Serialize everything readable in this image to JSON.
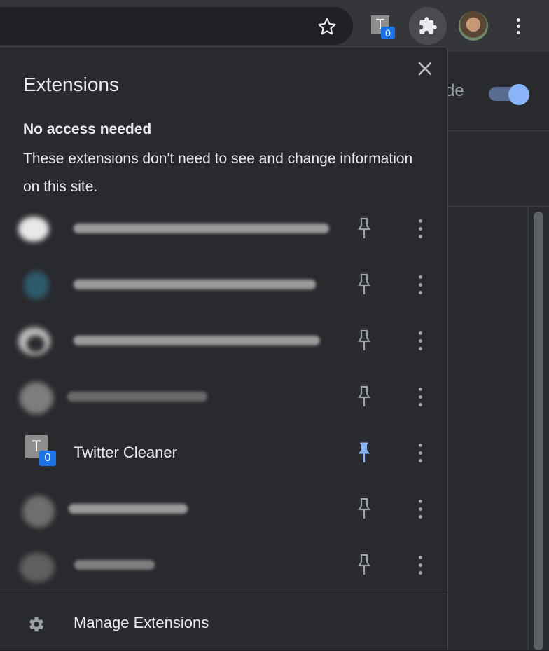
{
  "toolbar": {
    "pinned_extension": {
      "letter": "T",
      "badge": "0"
    },
    "icons": [
      "star-icon",
      "puzzle-icon",
      "avatar",
      "more-vert-icon"
    ]
  },
  "background": {
    "partial_text": "de"
  },
  "popup": {
    "title": "Extensions",
    "section": {
      "heading": "No access needed",
      "description": "These extensions don't need to see and change information on this site."
    },
    "extensions": [
      {
        "name": "",
        "pinned": false,
        "redacted": true
      },
      {
        "name": "",
        "pinned": false,
        "redacted": true
      },
      {
        "name": "",
        "pinned": false,
        "redacted": true
      },
      {
        "name": "",
        "pinned": false,
        "redacted": true
      },
      {
        "name": "Twitter Cleaner",
        "icon_letter": "T",
        "badge": "0",
        "pinned": true,
        "redacted": false
      },
      {
        "name": "",
        "pinned": false,
        "redacted": true
      },
      {
        "name": "",
        "pinned": false,
        "redacted": true
      }
    ],
    "manage_label": "Manage Extensions"
  },
  "colors": {
    "pin_active": "#8ab4f8",
    "pin_inactive": "#9aa0a6",
    "badge": "#1a73e8",
    "popup_bg": "#292a2d"
  }
}
